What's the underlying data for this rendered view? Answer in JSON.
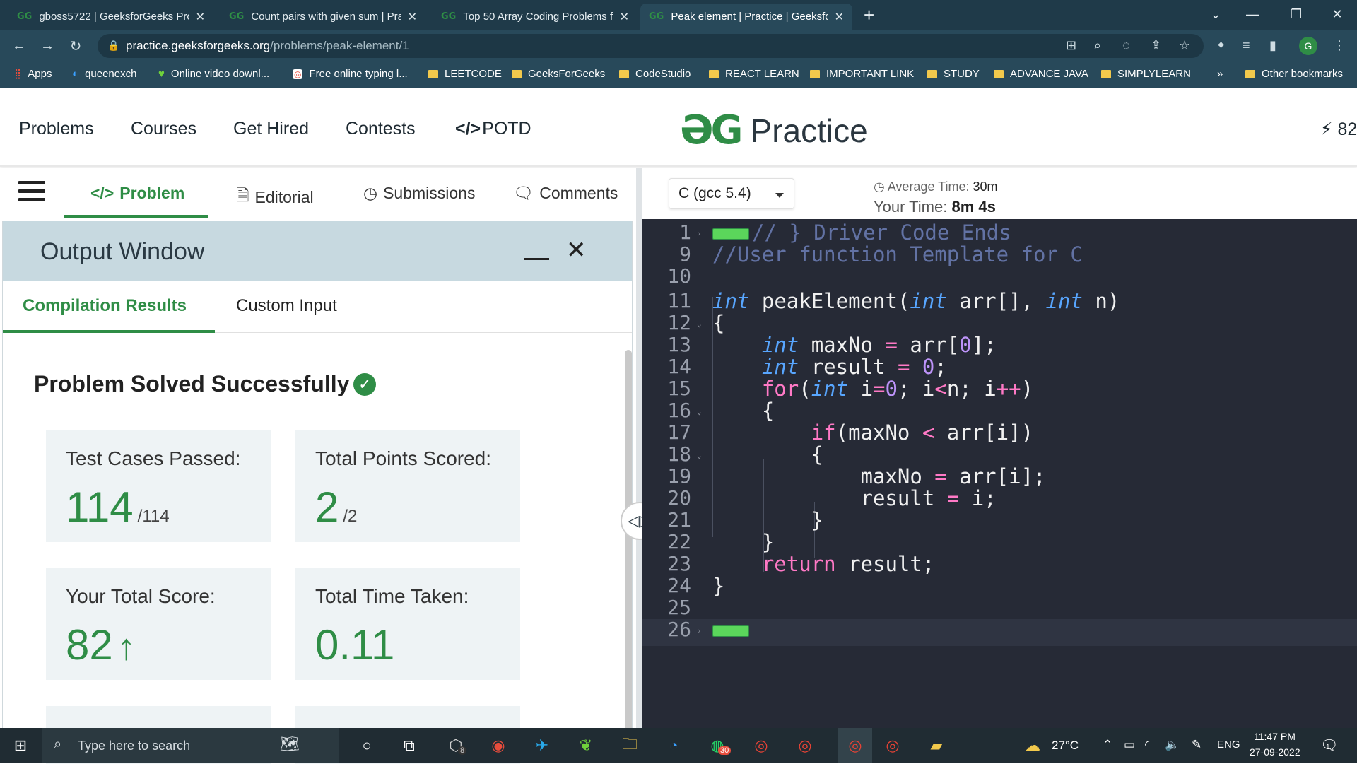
{
  "browser": {
    "tabs": [
      {
        "title": "gboss5722 | GeeksforGeeks Profi",
        "active": false
      },
      {
        "title": "Count pairs with given sum | Prac",
        "active": false
      },
      {
        "title": "Top 50 Array Coding Problems fo",
        "active": false
      },
      {
        "title": "Peak element | Practice | Geeksfo",
        "active": true
      }
    ],
    "new_tab": "+",
    "url_domain": "practice.geeksforgeeks.org",
    "url_path": "/problems/peak-element/1",
    "profile_initial": "G",
    "bookmarks": [
      {
        "label": "Apps",
        "icon": "apps-grid-icon"
      },
      {
        "label": "queenexch",
        "icon": "site-icon"
      },
      {
        "label": "Online video downl...",
        "icon": "site-icon"
      },
      {
        "label": "Free online typing l...",
        "icon": "site-icon"
      },
      {
        "label": "LEETCODE",
        "icon": "folder-icon"
      },
      {
        "label": "GeeksForGeeks",
        "icon": "folder-icon"
      },
      {
        "label": "CodeStudio",
        "icon": "folder-icon"
      },
      {
        "label": "REACT LEARN",
        "icon": "folder-icon"
      },
      {
        "label": "IMPORTANT LINK",
        "icon": "folder-icon"
      },
      {
        "label": "STUDY",
        "icon": "folder-icon"
      },
      {
        "label": "ADVANCE JAVA",
        "icon": "folder-icon"
      },
      {
        "label": "SIMPLYLEARN",
        "icon": "folder-icon"
      }
    ],
    "bookmarks_more": "»",
    "other_bookmarks": "Other bookmarks"
  },
  "site": {
    "nav": [
      "Problems",
      "Courses",
      "Get Hired",
      "Contests",
      "POTD"
    ],
    "potd_icon": "</>",
    "logo_text": "Practice",
    "streak": "82"
  },
  "left": {
    "tabs": [
      "Problem",
      "Editorial",
      "Submissions",
      "Comments"
    ],
    "output_title": "Output Window",
    "output_tabs": [
      "Compilation Results",
      "Custom Input"
    ],
    "status": "Problem Solved Successfully",
    "cards": [
      {
        "label": "Test Cases Passed:",
        "value": "114",
        "sub": "/114"
      },
      {
        "label": "Total Points Scored:",
        "value": "2",
        "sub": "/2"
      },
      {
        "label": "Your Total Score:",
        "value": "82",
        "sub": "↑"
      },
      {
        "label": "Total Time Taken:",
        "value": "0.11",
        "sub": ""
      }
    ]
  },
  "right": {
    "language": "C (gcc 5.4)",
    "avg_label": "Average Time:",
    "avg_value": "30m",
    "your_label": "Your Time:",
    "your_value": "8m 4s"
  },
  "code": {
    "lines": [
      {
        "n": "1",
        "text": "// } Driver Code Ends"
      },
      {
        "n": "9",
        "text": "//User function Template for C"
      },
      {
        "n": "10",
        "text": ""
      },
      {
        "n": "11",
        "text": "int peakElement(int arr[], int n)"
      },
      {
        "n": "12",
        "text": "{"
      },
      {
        "n": "13",
        "text": "    int maxNo = arr[0];"
      },
      {
        "n": "14",
        "text": "    int result = 0;"
      },
      {
        "n": "15",
        "text": "    for(int i=0; i<n; i++)"
      },
      {
        "n": "16",
        "text": "    {"
      },
      {
        "n": "17",
        "text": "        if(maxNo < arr[i])"
      },
      {
        "n": "18",
        "text": "        {"
      },
      {
        "n": "19",
        "text": "            maxNo = arr[i];"
      },
      {
        "n": "20",
        "text": "            result = i;"
      },
      {
        "n": "21",
        "text": "        }"
      },
      {
        "n": "22",
        "text": "    }"
      },
      {
        "n": "23",
        "text": "    return result;"
      },
      {
        "n": "24",
        "text": "}"
      },
      {
        "n": "25",
        "text": ""
      },
      {
        "n": "26",
        "text": ""
      }
    ]
  },
  "taskbar": {
    "search_placeholder": "Type here to search",
    "badge_8": "8",
    "badge_30": "30",
    "weather": "27°C",
    "lang": "ENG",
    "time": "11:47 PM",
    "date": "27-09-2022",
    "notif_count": "1"
  },
  "colors": {
    "accent": "#2f8d46",
    "chrome": "#28495a",
    "editor_bg": "#262a36"
  }
}
